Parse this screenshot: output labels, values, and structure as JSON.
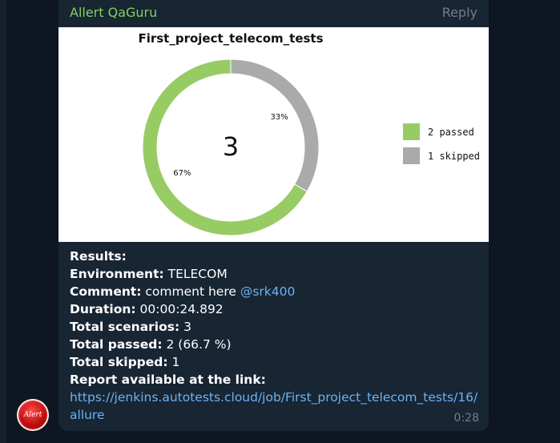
{
  "message": {
    "sender": "Allert QaGuru",
    "reply_label": "Reply",
    "time": "0:28",
    "avatar_text": "Alert"
  },
  "chart_data": {
    "type": "pie",
    "title": "First_project_telecom_tests",
    "center_label": "3",
    "categories": [
      "2 passed",
      "1 skipped"
    ],
    "values": [
      2,
      1
    ],
    "percent_labels": [
      "67%",
      "33%"
    ],
    "colors": [
      "#97cc64",
      "#aaaaaa"
    ],
    "legend_position": "right",
    "donut": true
  },
  "results": {
    "heading": "Results:",
    "environment_label": "Environment:",
    "environment_value": " TELECOM",
    "comment_label": "Comment:",
    "comment_value": " comment here ",
    "comment_mention": "@srk400",
    "duration_label": "Duration:",
    "duration_value": " 00:00:24.892",
    "total_scenarios_label": "Total scenarios:",
    "total_scenarios_value": " 3",
    "total_passed_label": "Total passed:",
    "total_passed_value": " 2 (66.7 %)",
    "total_skipped_label": "Total skipped:",
    "total_skipped_value": " 1",
    "report_label": "Report available at the link:",
    "report_link_line1": "https://jenkins.autotests.cloud/job/First_project_telecom_tests/16/",
    "report_link_line2": "allure"
  }
}
